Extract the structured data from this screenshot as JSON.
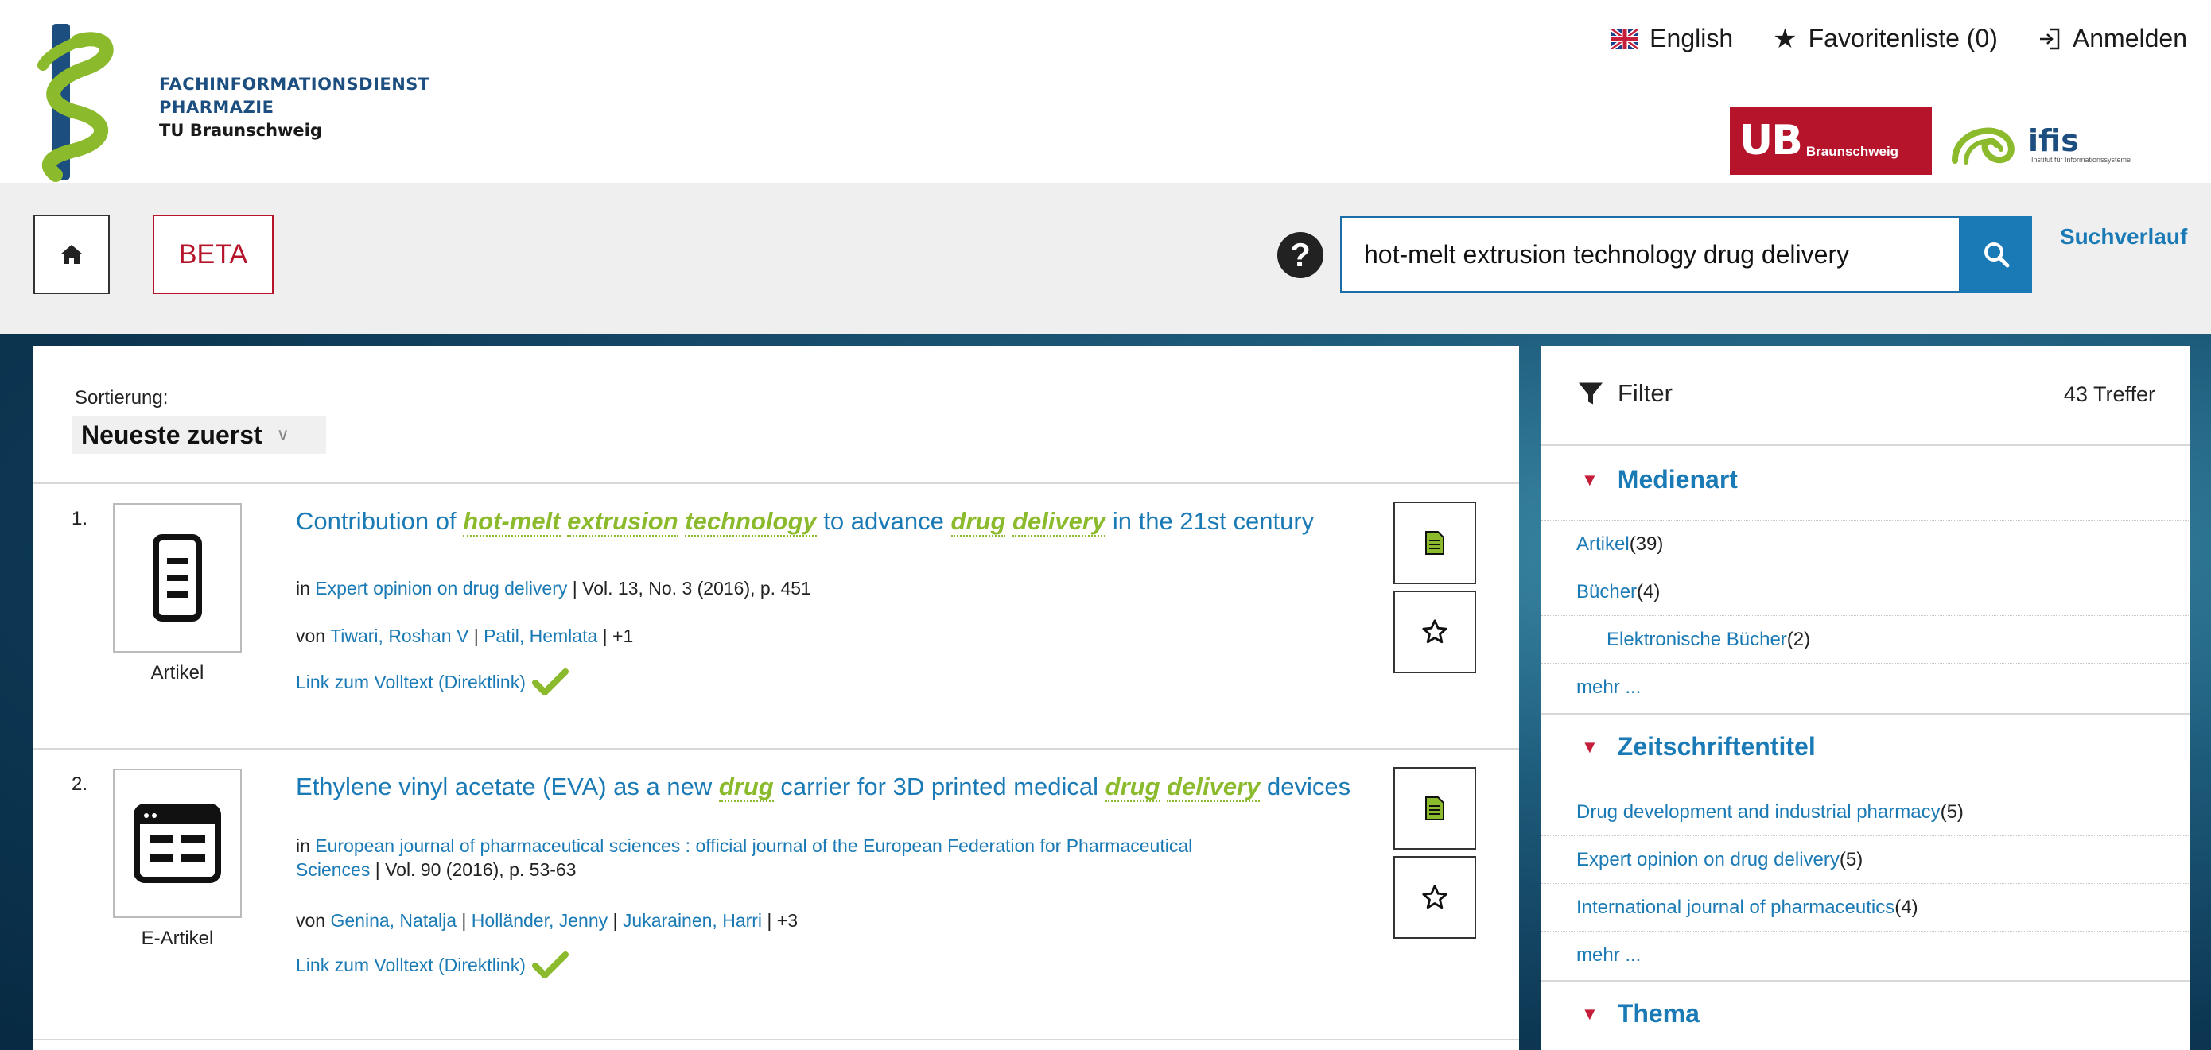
{
  "logo": {
    "line1": "FACHINFORMATIONSDIENST",
    "line2": "PHARMAZIE",
    "line3": "TU Braunschweig"
  },
  "topnav": {
    "language": "English",
    "favorites": "Favoritenliste (0)",
    "login": "Anmelden"
  },
  "partners": {
    "ub_main": "UB",
    "ub_sub": "Braunschweig",
    "ifis_name": "ifis",
    "ifis_sub": "Institut für Informationssysteme"
  },
  "toolbar": {
    "beta_label": "BETA",
    "search_value": "hot-melt extrusion technology drug delivery",
    "history_label": "Suchverlauf"
  },
  "sorting": {
    "label": "Sortierung:",
    "selected": "Neueste zuerst"
  },
  "results": [
    {
      "number": "1.",
      "type": "Artikel",
      "title_parts": [
        "Contribution of ",
        "hot-melt",
        " ",
        "extrusion",
        " ",
        "technology",
        " to advance ",
        "drug",
        " ",
        "delivery",
        " in the 21st century"
      ],
      "in_prefix": "in ",
      "source": "Expert opinion on drug delivery",
      "source_detail": " | Vol. 13, No. 3 (2016), p. 451",
      "authors_prefix": "von ",
      "authors": [
        "Tiwari, Roshan V",
        "Patil, Hemlata"
      ],
      "authors_more": " | +1",
      "fulltext": "Link zum Volltext (Direktlink)"
    },
    {
      "number": "2.",
      "type": "E-Artikel",
      "title_parts": [
        "Ethylene vinyl acetate (EVA) as a new ",
        "drug",
        " carrier for 3D printed medical ",
        "drug",
        " ",
        "delivery",
        " devices"
      ],
      "in_prefix": "in ",
      "source": "European journal of pharmaceutical sciences : official journal of the European Federation for Pharmaceutical Sciences",
      "source_detail": " | Vol. 90 (2016), p. 53-63",
      "authors_prefix": "von ",
      "authors": [
        "Genina, Natalja",
        "Holländer, Jenny",
        "Jukarainen, Harri"
      ],
      "authors_more": " | +3",
      "fulltext": "Link zum Volltext (Direktlink)"
    }
  ],
  "filter": {
    "title": "Filter",
    "count": "43 Treffer",
    "sections": [
      {
        "title": "Medienart",
        "items": [
          {
            "label": "Artikel",
            "count": " (39)"
          },
          {
            "label": "Bücher",
            "count": " (4)"
          },
          {
            "label": "Elektronische Bücher",
            "count": " (2)"
          },
          {
            "label": "mehr ...",
            "count": ""
          }
        ]
      },
      {
        "title": "Zeitschriftentitel",
        "items": [
          {
            "label": "Drug development and industrial pharmacy",
            "count": " (5)"
          },
          {
            "label": "Expert opinion on drug delivery",
            "count": " (5)"
          },
          {
            "label": "International journal of pharmaceutics",
            "count": " (4)"
          },
          {
            "label": "mehr ...",
            "count": ""
          }
        ]
      },
      {
        "title": "Thema",
        "items": []
      }
    ]
  },
  "colors": {
    "link_blue": "#1a7ab5",
    "highlight_green": "#8cba2d",
    "accent_red": "#b5142b"
  }
}
